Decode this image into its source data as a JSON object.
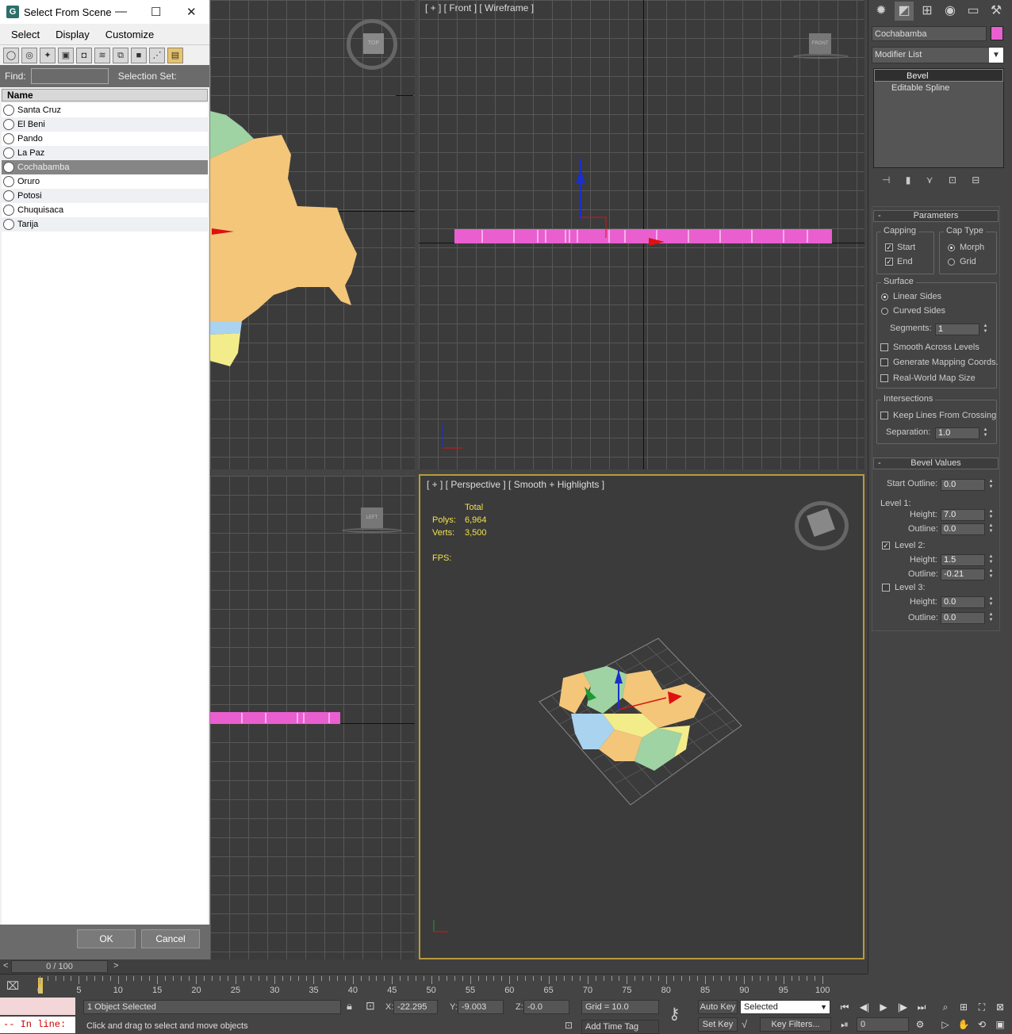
{
  "dialog": {
    "title": "Select From Scene",
    "icon_letter": "G",
    "menu": [
      "Select",
      "Display",
      "Customize"
    ],
    "find_label": "Find:",
    "find_value": "",
    "selection_set_label": "Selection Set:",
    "column_header": "Name",
    "objects": [
      "Santa Cruz",
      "El Beni",
      "Pando",
      "La Paz",
      "Cochabamba",
      "Oruro",
      "Potosi",
      "Chuquisaca",
      "Tarija"
    ],
    "selected_object": "Cochabamba",
    "ok_label": "OK",
    "cancel_label": "Cancel",
    "min_glyph": "—",
    "max_glyph": "☐",
    "close_glyph": "✕"
  },
  "viewports": {
    "front_label": "[ + ] [ Front ] [ Wireframe ]",
    "perspective_label": "[ + ] [ Perspective ] [ Smooth + Highlights ]",
    "stats": {
      "total_label": "Total",
      "polys_label": "Polys:",
      "polys_value": "6,964",
      "verts_label": "Verts:",
      "verts_value": "3,500",
      "fps_label": "FPS:"
    },
    "top_cube_label": "TOP",
    "front_cube_label": "FRONT",
    "left_cube_label": "LEFT"
  },
  "command_panel": {
    "object_name": "Cochabamba",
    "object_color": "#e95fcf",
    "modifier_list_label": "Modifier List",
    "stack": [
      {
        "label": "Bevel",
        "active": true
      },
      {
        "label": "Editable Spline",
        "active": false
      }
    ],
    "parameters": {
      "title": "Parameters",
      "capping_title": "Capping",
      "capping_start": "Start",
      "capping_end": "End",
      "cap_type_title": "Cap Type",
      "cap_morph": "Morph",
      "cap_grid": "Grid",
      "surface_title": "Surface",
      "linear_sides": "Linear Sides",
      "curved_sides": "Curved Sides",
      "segments_label": "Segments:",
      "segments_value": "1",
      "smooth_across": "Smooth Across Levels",
      "gen_mapping": "Generate Mapping Coords.",
      "real_world": "Real-World Map Size",
      "intersections_title": "Intersections",
      "keep_lines": "Keep Lines From Crossing",
      "separation_label": "Separation:",
      "separation_value": "1.0"
    },
    "bevel_values": {
      "title": "Bevel Values",
      "start_outline_label": "Start Outline:",
      "start_outline_value": "0.0",
      "level1_label": "Level 1:",
      "level1_height": "7.0",
      "level1_outline": "0.0",
      "level2_label": "Level 2:",
      "level2_height": "1.5",
      "level2_outline": "-0.21",
      "level3_label": "Level 3:",
      "level3_height": "0.0",
      "level3_outline": "0.0",
      "height_label": "Height:",
      "outline_label": "Outline:"
    }
  },
  "timeline": {
    "frame_display": "0 / 100",
    "ticks": [
      "0",
      "5",
      "10",
      "15",
      "20",
      "25",
      "30",
      "35",
      "40",
      "45",
      "50",
      "55",
      "60",
      "65",
      "70",
      "75",
      "80",
      "85",
      "90",
      "95",
      "100"
    ]
  },
  "status": {
    "maxscript_text": "-- In line:",
    "selection_text": "1 Object Selected",
    "prompt_text": "Click and drag to select and move objects",
    "x_label": "X:",
    "x_value": "-22.295",
    "y_label": "Y:",
    "y_value": "-9.003",
    "z_label": "Z:",
    "z_value": "-0.0",
    "grid_text": "Grid = 10.0",
    "add_time_tag": "Add Time Tag",
    "auto_key": "Auto Key",
    "set_key": "Set Key",
    "selected_dropdown": "Selected",
    "key_filters": "Key Filters...",
    "frame_value": "0"
  }
}
